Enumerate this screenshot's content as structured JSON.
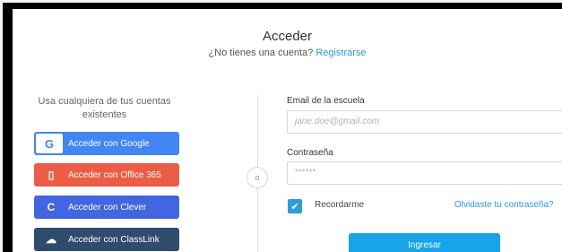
{
  "header": {
    "title": "Acceder",
    "subtitle_prefix": "¿No tienes una cuenta?",
    "signup_link": "Registrarse"
  },
  "left": {
    "intro": "Usa cualquiera de tus cuentas existentes",
    "buttons": [
      {
        "label": "Acceder con Google",
        "icon": "google-icon",
        "glyph": "G",
        "color": "#4285f4"
      },
      {
        "label": "Acceder con Office 365",
        "icon": "office-icon",
        "glyph": "▯",
        "color": "#eb5d46"
      },
      {
        "label": "Acceder con Clever",
        "icon": "clever-icon",
        "glyph": "C",
        "color": "#4265e0"
      },
      {
        "label": "Acceder con ClassLink",
        "icon": "classlink-icon",
        "glyph": "☁",
        "color": "#2f4b6e"
      }
    ]
  },
  "separator": "o",
  "form": {
    "email_label": "Email de la escuela",
    "email_placeholder": "jane.doe@gmail.com",
    "password_label": "Contraseña",
    "password_placeholder": "******",
    "remember_label": "Recordarme",
    "remember_checked": true,
    "forgot_link": "Olvidaste tu contraseña?",
    "submit_label": "Ingresar"
  }
}
